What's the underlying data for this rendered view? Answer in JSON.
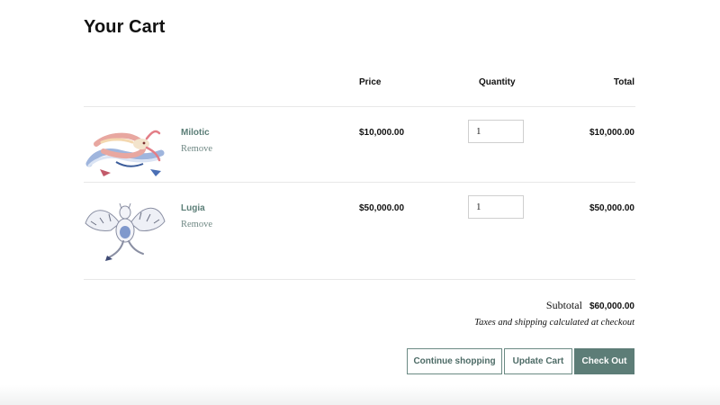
{
  "page": {
    "title": "Your Cart"
  },
  "table": {
    "headers": {
      "price": "Price",
      "quantity": "Quantity",
      "total": "Total"
    }
  },
  "items": [
    {
      "name": "Milotic",
      "remove_label": "Remove",
      "price": "$10,000.00",
      "quantity": "1",
      "total": "$10,000.00",
      "image": "milotic-image"
    },
    {
      "name": "Lugia",
      "remove_label": "Remove",
      "price": "$50,000.00",
      "quantity": "1",
      "total": "$50,000.00",
      "image": "lugia-image"
    }
  ],
  "summary": {
    "subtotal_label": "Subtotal",
    "subtotal_value": "$60,000.00",
    "tax_note": "Taxes and shipping calculated at checkout"
  },
  "actions": {
    "continue_label": "Continue shopping",
    "update_label": "Update Cart",
    "checkout_label": "Check Out"
  },
  "colors": {
    "accent": "#5d7d77",
    "link": "#5b7e77",
    "border": "#e8e8e8"
  }
}
